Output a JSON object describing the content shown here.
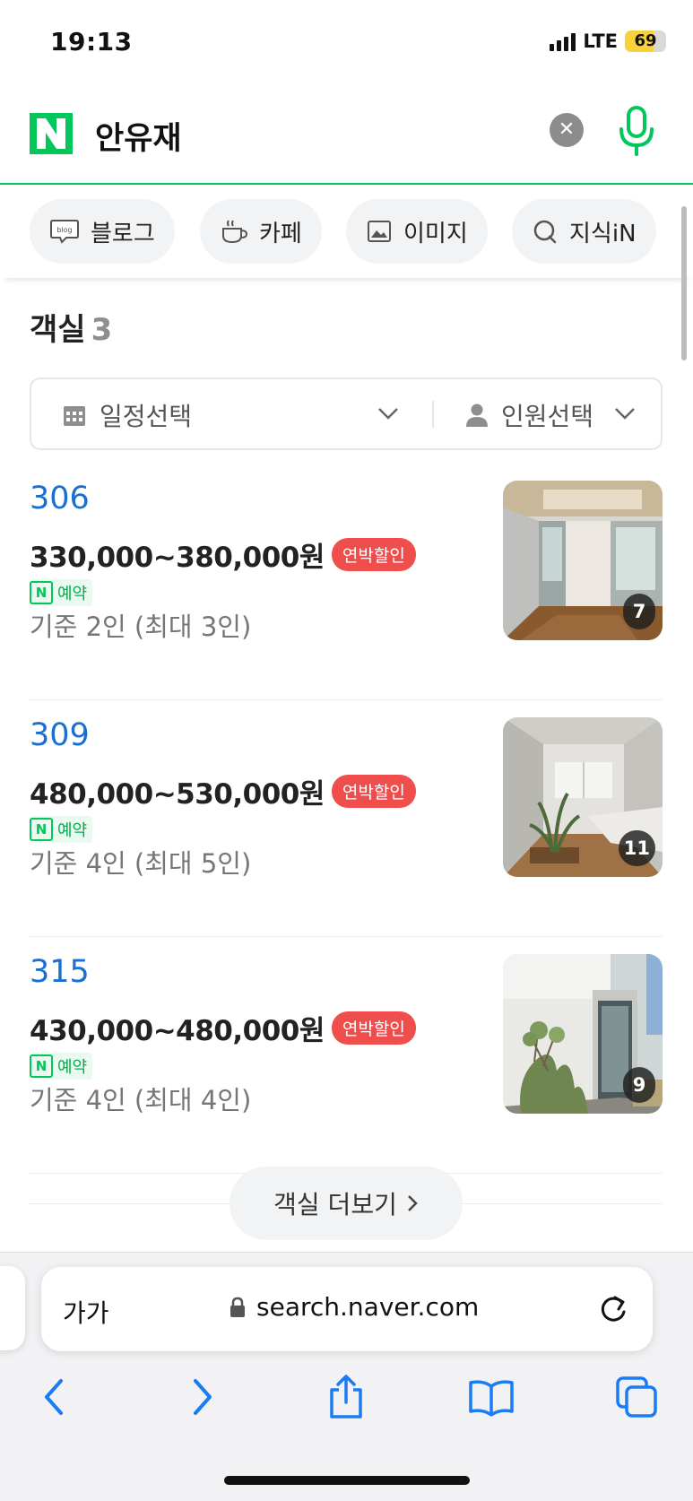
{
  "status_bar": {
    "time": "19:13",
    "network": "LTE",
    "battery_percent": "69",
    "battery_level": 0.69,
    "colors": {
      "battery_fill": "#f8d23a"
    }
  },
  "search": {
    "logo_letter": "N",
    "query": "안유재",
    "icons": {
      "clear": "close-icon",
      "mic": "microphone-icon"
    },
    "colors": {
      "brand": "#03c75a"
    }
  },
  "tabs": [
    {
      "label": "블로그",
      "icon": "blog-icon"
    },
    {
      "label": "카페",
      "icon": "cafe-icon"
    },
    {
      "label": "이미지",
      "icon": "image-icon"
    },
    {
      "label": "지식iN",
      "icon": "knowledge-icon"
    }
  ],
  "rooms_section": {
    "title": "객실",
    "count": "3",
    "filter": {
      "date_label": "일정선택",
      "people_label": "인원선택"
    },
    "rooms": [
      {
        "name": "306",
        "price": "330,000~380,000원",
        "badge": "연박할인",
        "reserve_label": "예약",
        "capacity": "기준 2인 (최대 3인)",
        "photo_count": "7"
      },
      {
        "name": "309",
        "price": "480,000~530,000원",
        "badge": "연박할인",
        "reserve_label": "예약",
        "capacity": "기준 4인 (최대 5인)",
        "photo_count": "11"
      },
      {
        "name": "315",
        "price": "430,000~480,000원",
        "badge": "연박할인",
        "reserve_label": "예약",
        "capacity": "기준 4인 (최대 4인)",
        "photo_count": "9"
      }
    ],
    "more_label": "객실 더보기",
    "colors": {
      "room_name": "#1b6fd0",
      "badge": "#f04d4d",
      "reserve": "#03c75a"
    }
  },
  "browser": {
    "text_size_button": "가가",
    "url": "search.naver.com",
    "icons": {
      "lock": "lock-icon",
      "reload": "reload-icon",
      "back": "back-arrow-icon",
      "forward": "forward-arrow-icon",
      "share": "share-icon",
      "bookmarks": "bookmarks-icon",
      "tabs": "tabs-icon"
    },
    "colors": {
      "toolbar_icons": "#1a7cf3"
    }
  }
}
